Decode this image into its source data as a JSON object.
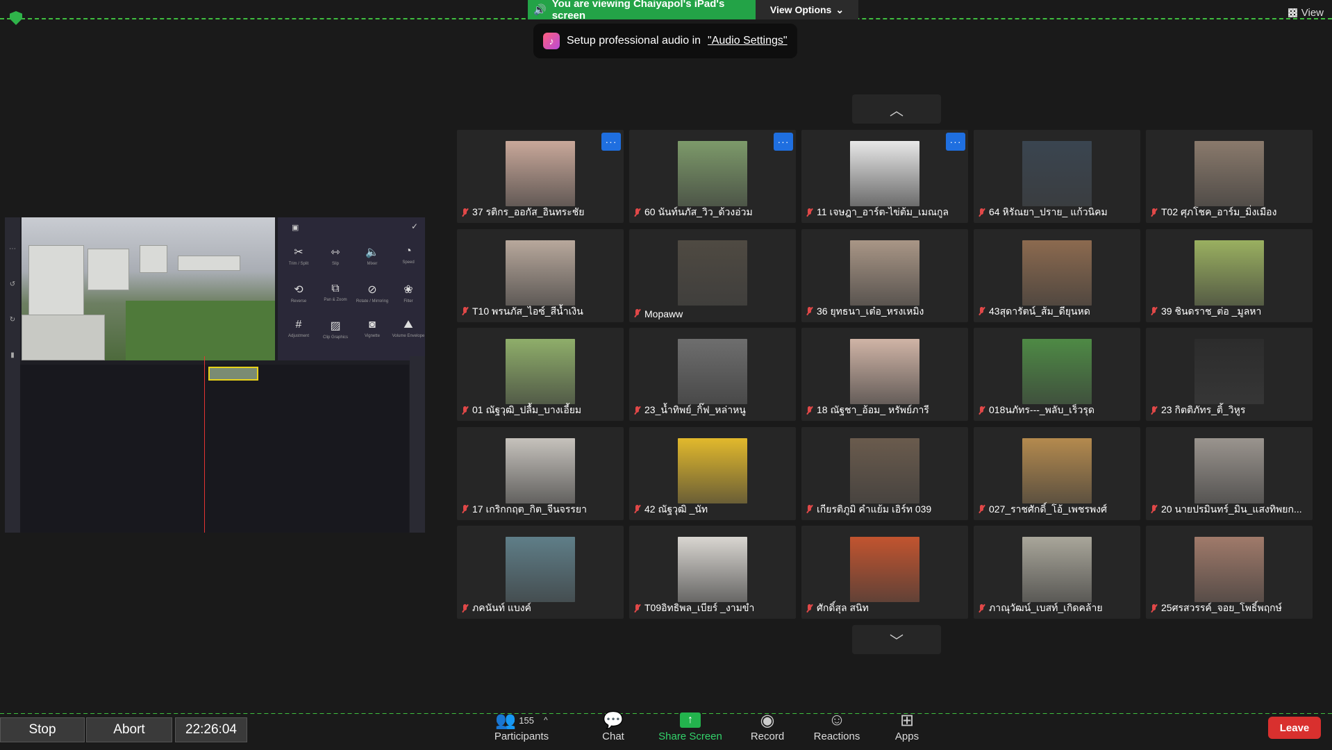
{
  "banner": {
    "sharing_text": "You are viewing Chaiyapol's iPad's screen",
    "view_options": "View Options",
    "view": "View"
  },
  "audio_tip": {
    "text": "Setup professional audio in",
    "link": "\"Audio Settings\""
  },
  "participants": [
    {
      "name": "37 รติกร_ออกัส_อินทระชัย",
      "more": true,
      "color": "#c9a89a"
    },
    {
      "name": "60 นันท์นภัส_วิว_ด้วงอ่วม",
      "more": true,
      "color": "#7d9a6a"
    },
    {
      "name": "11 เจษฎา_อาร์ต-ไข่ต้ม_เมณกูล",
      "more": true,
      "color": "#e8e8e8"
    },
    {
      "name": "64 หิรัณยา_ปราย_ แก้วนิคม",
      "more": false,
      "color": "#3a4550"
    },
    {
      "name": "T02 ศุภโชค_อาร์ม_มิ่งเมือง",
      "more": false,
      "color": "#8a7a6c"
    },
    {
      "name": "T10 พรนภัส_ไอซ์_สีน้ำเงิน",
      "more": false,
      "color": "#b8a89c"
    },
    {
      "name": "Mopaww",
      "more": false,
      "color": "#4f4a42"
    },
    {
      "name": "36 ยุทธนา_เต๋อ_หรงเหมิง",
      "more": false,
      "color": "#a99686"
    },
    {
      "name": "43สุดารัตน์_ส้ม_ดียุนหด",
      "more": false,
      "color": "#8c6a4f"
    },
    {
      "name": "39 ชินดราช_ต่อ _มูลหา",
      "more": false,
      "color": "#9ab060"
    },
    {
      "name": "01 ณัฐวุฒิ_ปลื้ม_บางเอี้ยม",
      "more": false,
      "color": "#8fae6a"
    },
    {
      "name": "23_น้ำทิพย์_กิ๊ฟ_หล่าหนู",
      "more": false,
      "color": "#6e6e6e"
    },
    {
      "name": "18 ณัฐชา_อ้อม_ หรัพย์ภารี",
      "more": false,
      "color": "#d0b4a6"
    },
    {
      "name": "018นภัทร---_พลับ_เร็วรุด",
      "more": false,
      "color": "#4e8a45"
    },
    {
      "name": "23 กิตติภัทร_ติ้_วิหูร",
      "more": false,
      "color": "#2c2c2c"
    },
    {
      "name": "17 เกริกกฤต_กิต_จีนจรรยา",
      "more": false,
      "color": "#c6c2bc"
    },
    {
      "name": "42 ณัฐวุฒิ _นัท",
      "more": false,
      "color": "#e2b92c"
    },
    {
      "name": "เกียรติภูมิ คำแย้ม เอิร์ท 039",
      "more": false,
      "color": "#6a5b4d"
    },
    {
      "name": "027_ราชศักดิ์_โอ้_เพชรพงศ์",
      "more": false,
      "color": "#b48a4e"
    },
    {
      "name": "20 นายปรมินทร์_มิน_แสงทิพยก...",
      "more": false,
      "color": "#9a948e"
    },
    {
      "name": "ภคนันท์ แบงค์",
      "more": false,
      "color": "#5f7e88"
    },
    {
      "name": "T09อิทธิพล_เบียร์ _งามขำ",
      "more": false,
      "color": "#d9d6d1"
    },
    {
      "name": "ศักดิ์สุล สนิท",
      "more": false,
      "color": "#c2542f"
    },
    {
      "name": "ภาณุวัฒน์_เบสท์_เกิดคล้าย",
      "more": false,
      "color": "#a9a69a"
    },
    {
      "name": "25ศรสวรรค์_จอย_โพธิ์พฤกษ์",
      "more": false,
      "color": "#a07a6a"
    }
  ],
  "recording": {
    "stop": "Stop",
    "abort": "Abort",
    "time": "22:26:04"
  },
  "toolbar": {
    "participants": "Participants",
    "participants_count": "155",
    "chat": "Chat",
    "share_screen": "Share Screen",
    "record": "Record",
    "reactions": "Reactions",
    "apps": "Apps",
    "leave": "Leave"
  },
  "colors": {
    "accent_green": "#23a347",
    "leave_red": "#d9302e",
    "more_blue": "#1f6fe0"
  }
}
